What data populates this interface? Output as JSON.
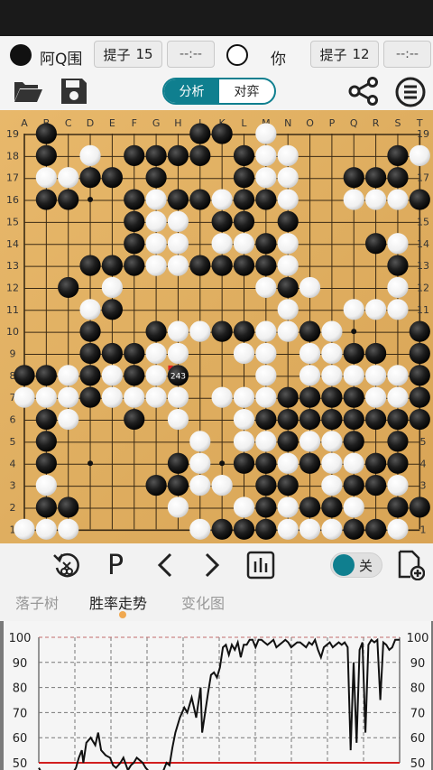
{
  "players": {
    "black_name": "阿Q围",
    "white_name": "你",
    "capture_label": "提子",
    "black_captures": "15",
    "white_captures": "12",
    "black_time": "--:--",
    "white_time": "--:--"
  },
  "mode_tabs": {
    "analysis": "分析",
    "play": "对弈"
  },
  "controls": {
    "pass_label": "P",
    "toggle_label": "关"
  },
  "bottom_tabs": {
    "tree": "落子树",
    "winrate": "胜率走势",
    "variation": "变化图"
  },
  "board": {
    "columns": [
      "A",
      "B",
      "C",
      "D",
      "E",
      "F",
      "G",
      "H",
      "J",
      "K",
      "L",
      "M",
      "N",
      "O",
      "P",
      "Q",
      "R",
      "S",
      "T"
    ],
    "rows": [
      "_B______BB_W_______",
      "_B_W_BBBB_BWW____BW",
      "_WWBB_B___BWW__BBB_",
      "_BB__BWBBWBBW__WWWBW",
      "_____BWW_BB_B______",
      "_____BWW_WWBW___BW_",
      "___BBBWWBBBBW____B_",
      "__B_W______WBW___W_",
      "___WB_______W__WWW_",
      "___B__BWWBBWWBW___B",
      "___BBBWW__WW_WWBB_B",
      "BBWBWBWW___W_WWWWWB",
      "WWWBWWWW_WWWBBBBWWB",
      "_BW__B_W__WBBBBBBBBW",
      "_B______W_WWBWWB_B_",
      "_B_____BW_BBWBWWBB_",
      "_W____BBWW_BB_WBBW_",
      "_BB____W__WBWBBW_BB",
      "WWW_____WBBBWWWBBW_",
      "_WWW__BWBBBWBWBB_B_"
    ],
    "last_move": {
      "col": "H",
      "row": 8,
      "number": "243"
    }
  },
  "chart_data": {
    "type": "line",
    "y_ticks": [
      50,
      60,
      70,
      80,
      90,
      100
    ],
    "ylim": [
      50,
      100
    ],
    "x": [
      0,
      3,
      6,
      9,
      12,
      15,
      18,
      20,
      22,
      25,
      27,
      29,
      30,
      32,
      35,
      38,
      40,
      42,
      45,
      48,
      50,
      52,
      55,
      57,
      60,
      62,
      64,
      66,
      68,
      70,
      72,
      75,
      78,
      80,
      82,
      84,
      86,
      88,
      90,
      92,
      95,
      98,
      100,
      103,
      106,
      109,
      110,
      112,
      114,
      116,
      118,
      120,
      122,
      124,
      126,
      128,
      130,
      132,
      134,
      136,
      138,
      140,
      142,
      144,
      146,
      148,
      150,
      152,
      154,
      156,
      158,
      160,
      162,
      164,
      166,
      168,
      170,
      172,
      174,
      176,
      178,
      180,
      182,
      184,
      186,
      188,
      190,
      192,
      194,
      196,
      198,
      200,
      202,
      204,
      206,
      208,
      210,
      212,
      214,
      216,
      218,
      220,
      222,
      224,
      226,
      228,
      230,
      232,
      234,
      236,
      238,
      240,
      243
    ],
    "series": [
      {
        "values": [
          48,
          45,
          44,
          42,
          46,
          40,
          38,
          41,
          45,
          48,
          52,
          55,
          50,
          58,
          60,
          57,
          62,
          55,
          53,
          52,
          49,
          48,
          50,
          52,
          47,
          49,
          50,
          52,
          51,
          50,
          48,
          46,
          42,
          40,
          41,
          47,
          50,
          49,
          56,
          62,
          68,
          72,
          70,
          76,
          68,
          80,
          62,
          70,
          78,
          85,
          86,
          84,
          88,
          96,
          97,
          93,
          97,
          95,
          98,
          92,
          97,
          97,
          99,
          99,
          96,
          99,
          99,
          98,
          97,
          98,
          99,
          96,
          97,
          98,
          99,
          98,
          96,
          97,
          98,
          98,
          97,
          96,
          98,
          97,
          99,
          95,
          92,
          96,
          97,
          98,
          96,
          97,
          98,
          97,
          98,
          96,
          55,
          90,
          58,
          95,
          98,
          62,
          97,
          99,
          98,
          99,
          75,
          98,
          97,
          95,
          96,
          99,
          99
        ]
      }
    ]
  }
}
